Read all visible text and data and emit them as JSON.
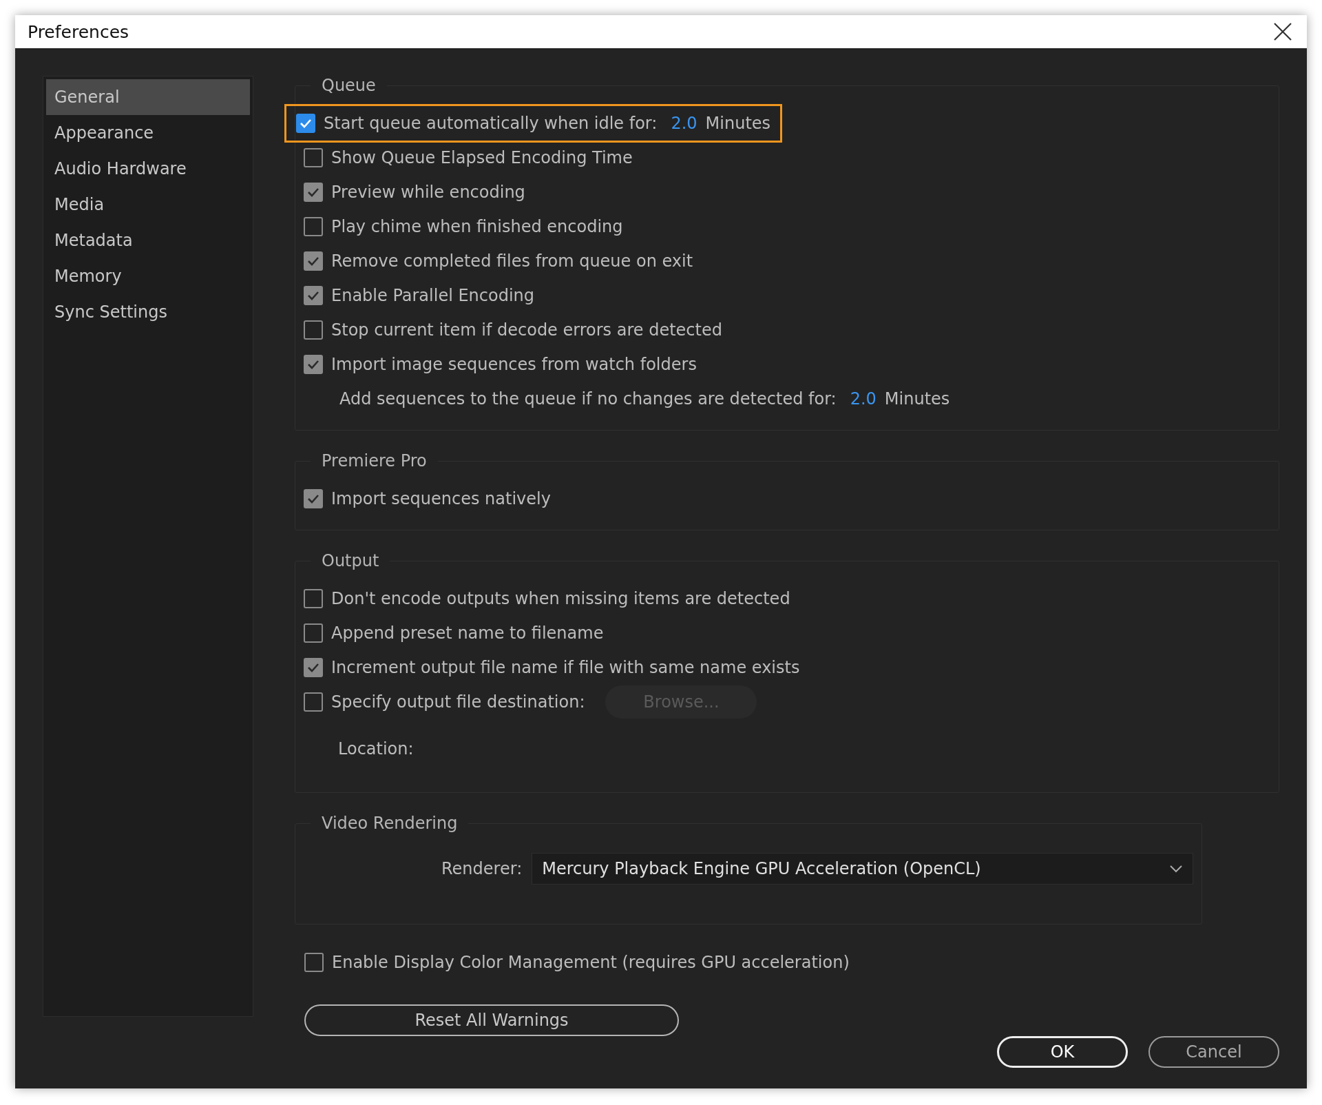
{
  "window": {
    "title": "Preferences"
  },
  "sidebar": {
    "items": [
      {
        "label": "General",
        "selected": true
      },
      {
        "label": "Appearance",
        "selected": false
      },
      {
        "label": "Audio Hardware",
        "selected": false
      },
      {
        "label": "Media",
        "selected": false
      },
      {
        "label": "Metadata",
        "selected": false
      },
      {
        "label": "Memory",
        "selected": false
      },
      {
        "label": "Sync Settings",
        "selected": false
      }
    ]
  },
  "groups": [
    {
      "title": "Queue",
      "items": [
        {
          "kind": "checkbox",
          "label": "Start queue automatically when idle for:",
          "checked": true,
          "focused": true,
          "value": "2.0",
          "unit": "Minutes"
        },
        {
          "kind": "checkbox",
          "label": "Show Queue Elapsed Encoding Time",
          "checked": false,
          "focused": false
        },
        {
          "kind": "checkbox",
          "label": "Preview while encoding",
          "checked": true,
          "focused": false
        },
        {
          "kind": "checkbox",
          "label": "Play chime when finished encoding",
          "checked": false,
          "focused": false
        },
        {
          "kind": "checkbox",
          "label": "Remove completed files from queue on exit",
          "checked": true,
          "focused": false
        },
        {
          "kind": "checkbox",
          "label": "Enable Parallel Encoding",
          "checked": true,
          "focused": false
        },
        {
          "kind": "checkbox",
          "label": "Stop current item if decode errors are detected",
          "checked": false,
          "focused": false
        },
        {
          "kind": "checkbox",
          "label": "Import image sequences from watch folders",
          "checked": true,
          "focused": false
        },
        {
          "kind": "setting",
          "label": "Add sequences to the queue if no changes are detected for:",
          "value": "2.0",
          "unit": "Minutes"
        }
      ]
    },
    {
      "title": "Premiere Pro",
      "items": [
        {
          "kind": "checkbox",
          "label": "Import sequences natively",
          "checked": true,
          "focused": false
        }
      ]
    },
    {
      "title": "Output",
      "items": [
        {
          "kind": "checkbox",
          "label": "Don't encode outputs when missing items are detected",
          "checked": false,
          "focused": false
        },
        {
          "kind": "checkbox",
          "label": "Append preset name to filename",
          "checked": false,
          "focused": false
        },
        {
          "kind": "checkbox",
          "label": "Increment output file name if file with same name exists",
          "checked": true,
          "focused": false
        },
        {
          "kind": "checkbox",
          "label": "Specify output file destination:",
          "checked": false,
          "focused": false,
          "button": {
            "label": "Browse...",
            "disabled": true
          }
        },
        {
          "kind": "location",
          "label": "Location:"
        }
      ]
    },
    {
      "title": "Video Rendering",
      "items": [
        {
          "kind": "select",
          "label": "Renderer:",
          "value": "Mercury Playback Engine GPU Acceleration (OpenCL)"
        }
      ]
    }
  ],
  "extra": [
    {
      "kind": "checkbox",
      "label": "Enable Display Color Management (requires GPU acceleration)",
      "checked": false,
      "focused": false
    },
    {
      "kind": "button",
      "label": "Reset All Warnings"
    }
  ],
  "footer": {
    "buttons": [
      {
        "label": "OK",
        "default": true
      },
      {
        "label": "Cancel",
        "default": false
      }
    ]
  }
}
